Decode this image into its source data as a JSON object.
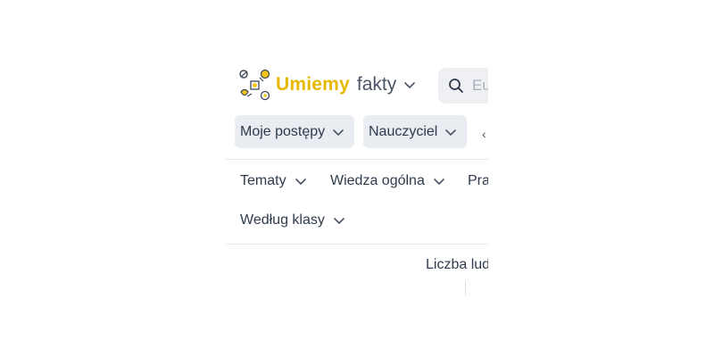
{
  "brand": {
    "name_primary": "Umiemy",
    "name_secondary": "fakty"
  },
  "search": {
    "placeholder": "Eu"
  },
  "buttons": {
    "progress": "Moje postępy",
    "teacher": "Nauczyciel"
  },
  "nav": {
    "topics": "Tematy",
    "general_knowledge": "Wiedza ogólna",
    "third": "Pra",
    "by_class": "Według klasy"
  },
  "content": {
    "stat_label": "Liczba lud"
  },
  "colors": {
    "brand": "#e6b800",
    "pill_bg": "#e9ecf1",
    "search_bg": "#eef0f4",
    "text": "#2f3b4c"
  }
}
